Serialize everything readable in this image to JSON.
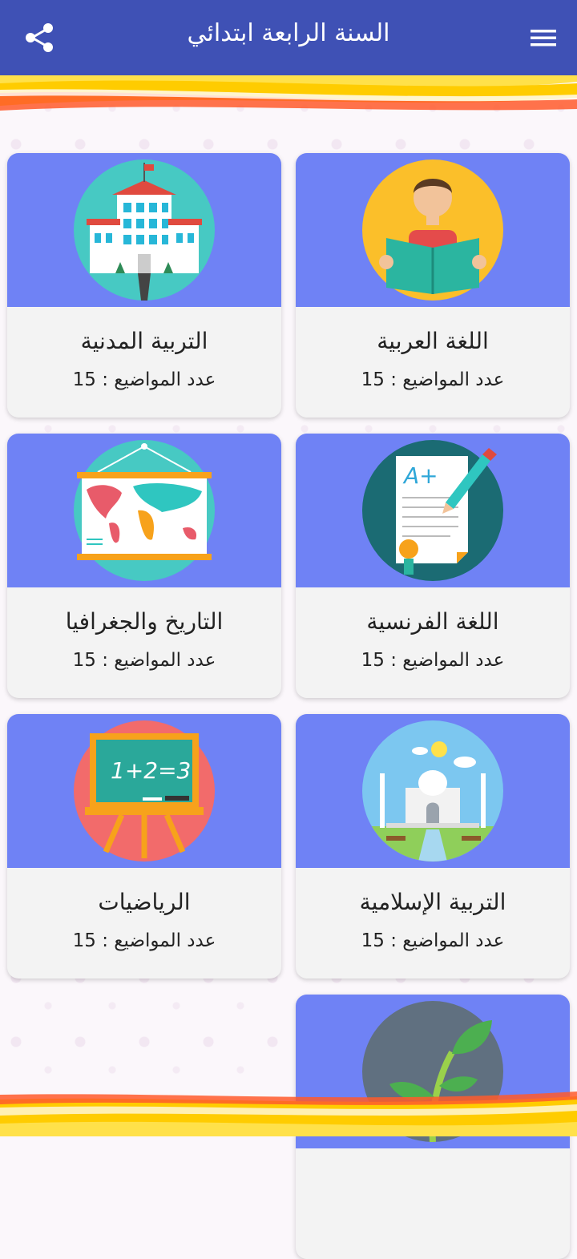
{
  "header": {
    "title": "السنة الرابعة ابتدائي"
  },
  "subjects": [
    {
      "name": "اللغة العربية",
      "count_label": "عدد المواضيع :",
      "count": "15",
      "icon": "reading-student-icon"
    },
    {
      "name": "التربية المدنية",
      "count_label": "عدد المواضيع :",
      "count": "15",
      "icon": "school-building-icon"
    },
    {
      "name": "اللغة الفرنسية",
      "count_label": "عدد المواضيع :",
      "count": "15",
      "icon": "graded-paper-icon"
    },
    {
      "name": "التاريخ والجغرافيا",
      "count_label": "عدد المواضيع :",
      "count": "15",
      "icon": "world-map-icon"
    },
    {
      "name": "التربية الإسلامية",
      "count_label": "عدد المواضيع :",
      "count": "15",
      "icon": "mosque-icon"
    },
    {
      "name": "الرياضيات",
      "count_label": "عدد المواضيع :",
      "count": "15",
      "icon": "chalkboard-icon"
    },
    {
      "name": "",
      "icon": "plant-sprout-icon"
    }
  ],
  "chalkboard_text": "1+2=3",
  "paper_grade": "A+",
  "colors": {
    "appbar": "#3f51b5",
    "card_top": "#6f82f5",
    "card_bottom": "#f3f3f3"
  }
}
